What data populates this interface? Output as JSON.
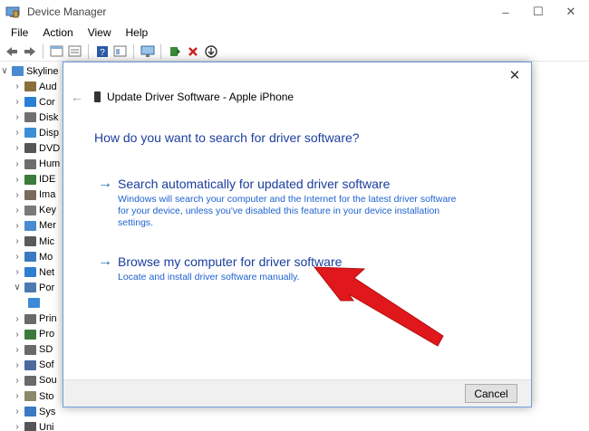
{
  "window": {
    "title": "Device Manager",
    "controls": {
      "minimize": "–",
      "maximize": "☐",
      "close": "✕"
    }
  },
  "menu": [
    "File",
    "Action",
    "View",
    "Help"
  ],
  "tree": {
    "root": "Skyline",
    "items": [
      {
        "label": "Aud",
        "color": "#8a6d3b"
      },
      {
        "label": "Cor",
        "color": "#2a7fd4"
      },
      {
        "label": "Disk",
        "color": "#707070"
      },
      {
        "label": "Disp",
        "color": "#3a8fd6"
      },
      {
        "label": "DVD",
        "color": "#555555"
      },
      {
        "label": "Hum",
        "color": "#6e6e6e"
      },
      {
        "label": "IDE",
        "color": "#3a7a3a"
      },
      {
        "label": "Ima",
        "color": "#7a6a5a"
      },
      {
        "label": "Key",
        "color": "#7a7a7a"
      },
      {
        "label": "Mer",
        "color": "#4a8ad0"
      },
      {
        "label": "Mic",
        "color": "#5a5a5a"
      },
      {
        "label": "Mo",
        "color": "#3a7ac0"
      },
      {
        "label": "Net",
        "color": "#2f7fd0"
      },
      {
        "label": "Por",
        "color": "#4a7ab0"
      },
      {
        "label": "",
        "color": "#3a8ad6"
      },
      {
        "label": "Prin",
        "color": "#6a6a6a"
      },
      {
        "label": "Pro",
        "color": "#3b7a3b"
      },
      {
        "label": "SD",
        "color": "#6a6a6a"
      },
      {
        "label": "Sof",
        "color": "#4a6aa0"
      },
      {
        "label": "Sou",
        "color": "#6a6a6a"
      },
      {
        "label": "Sto",
        "color": "#8a8a6a"
      },
      {
        "label": "Sys",
        "color": "#3a7ac0"
      },
      {
        "label": "Uni",
        "color": "#555555"
      }
    ]
  },
  "dialog": {
    "title": "Update Driver Software - Apple iPhone",
    "question": "How do you want to search for driver software?",
    "options": [
      {
        "title": "Search automatically for updated driver software",
        "description": "Windows will search your computer and the Internet for the latest driver software for your device, unless you've disabled this feature in your device installation settings."
      },
      {
        "title": "Browse my computer for driver software",
        "description": "Locate and install driver software manually."
      }
    ],
    "cancel_label": "Cancel"
  },
  "colors": {
    "link_title": "#1a3d9d",
    "link_desc": "#1e62d0",
    "annotation_arrow": "#e0171b"
  }
}
